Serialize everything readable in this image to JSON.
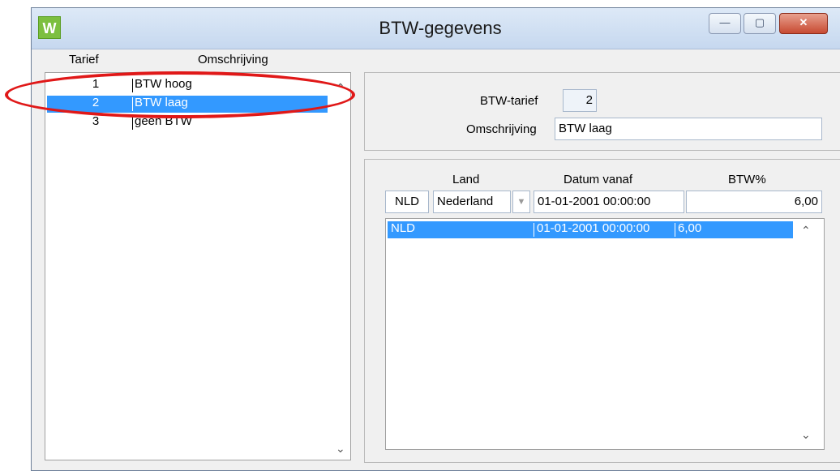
{
  "window": {
    "title": "BTW-gegevens",
    "app_icon": "W"
  },
  "controls": {
    "minimize": "—",
    "maximize": "▢",
    "close": "✕"
  },
  "left": {
    "headers": {
      "tarief": "Tarief",
      "omschrijving": "Omschrijving"
    },
    "rows": [
      {
        "num": "1",
        "desc": "BTW hoog",
        "selected": false
      },
      {
        "num": "2",
        "desc": "BTW laag",
        "selected": true
      },
      {
        "num": "3",
        "desc": "geen BTW",
        "selected": false
      }
    ]
  },
  "detail": {
    "btw_tarief_label": "BTW-tarief",
    "btw_tarief_value": "2",
    "omschrijving_label": "Omschrijving",
    "omschrijving_value": "BTW laag"
  },
  "rates": {
    "headers": {
      "land": "Land",
      "datum": "Datum vanaf",
      "btw": "BTW%"
    },
    "edit": {
      "code": "NLD",
      "country": "Nederland",
      "date": "01-01-2001 00:00:00",
      "pct": "6,00"
    },
    "rows": [
      {
        "code": "NLD",
        "date": "01-01-2001 00:00:00",
        "pct": "6,00"
      }
    ]
  },
  "colors": {
    "selection": "#3399ff",
    "annotation": "#e01818"
  }
}
